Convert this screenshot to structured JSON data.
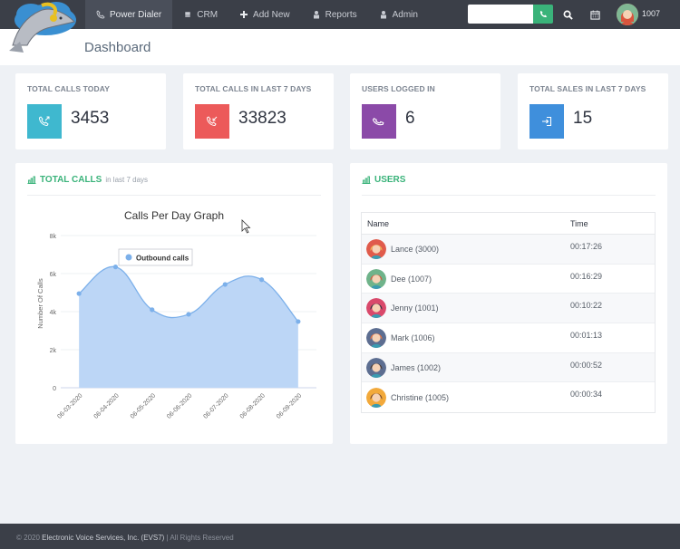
{
  "nav": {
    "items": [
      {
        "label": "Power Dialer",
        "icon": "phone-icon",
        "active": true
      },
      {
        "label": "CRM",
        "icon": "book-icon",
        "active": false
      },
      {
        "label": "Add New",
        "icon": "plus-icon",
        "active": false
      },
      {
        "label": "Reports",
        "icon": "user-icon",
        "active": false
      },
      {
        "label": "Admin",
        "icon": "user-icon",
        "active": false
      }
    ],
    "dial_input": {
      "value": "",
      "placeholder": ""
    },
    "user_extension": "1007"
  },
  "page": {
    "title": "Dashboard"
  },
  "stats": [
    {
      "label": "TOTAL CALLS TODAY",
      "value": "3453",
      "icon": "outgoing-call-icon",
      "color": "#3fb8cf"
    },
    {
      "label": "TOTAL CALLS IN LAST 7 DAYS",
      "value": "33823",
      "icon": "incoming-call-icon",
      "color": "#ec5a5a"
    },
    {
      "label": "USERS LOGGED IN",
      "value": "6",
      "icon": "phone-icon",
      "color": "#8b4aa8"
    },
    {
      "label": "TOTAL SALES IN LAST 7 DAYS",
      "value": "15",
      "icon": "sign-in-icon",
      "color": "#3f8fdc"
    }
  ],
  "calls_panel": {
    "title": "TOTAL CALLS",
    "subtitle": "in last 7 days"
  },
  "users_panel": {
    "title": "USERS",
    "columns": [
      "Name",
      "Time"
    ],
    "rows": [
      {
        "name": "Lance (3000)",
        "time": "00:17:26",
        "avatar_bg": "#e05b4b",
        "hair": "#f0b64a"
      },
      {
        "name": "Dee (1007)",
        "time": "00:16:29",
        "avatar_bg": "#6fb38a",
        "hair": "#d9553e"
      },
      {
        "name": "Jenny (1001)",
        "time": "00:10:22",
        "avatar_bg": "#d9496b",
        "hair": "#2f3440"
      },
      {
        "name": "Mark (1006)",
        "time": "00:01:13",
        "avatar_bg": "#5d6e91",
        "hair": "#e8713e"
      },
      {
        "name": "James (1002)",
        "time": "00:00:52",
        "avatar_bg": "#5d6e91",
        "hair": "#4a3a30"
      },
      {
        "name": "Christine (1005)",
        "time": "00:00:34",
        "avatar_bg": "#f2a93b",
        "hair": "#7a4a2a"
      }
    ]
  },
  "chart_data": {
    "type": "area",
    "title": "Calls Per Day Graph",
    "xlabel": "",
    "ylabel": "Number Of Calls",
    "categories": [
      "06-03-2020",
      "06-04-2020",
      "06-05-2020",
      "06-06-2020",
      "06-07-2020",
      "06-08-2020",
      "06-09-2020"
    ],
    "series": [
      {
        "name": "Outbound calls",
        "values": [
          4950,
          6350,
          4100,
          3860,
          5430,
          5680,
          3480
        ],
        "color": "#7cb0ea"
      }
    ],
    "yticks": [
      "0",
      "2k",
      "4k",
      "6k",
      "8k"
    ],
    "ylim": [
      0,
      8000
    ],
    "grid": true,
    "legend": "top-left"
  },
  "footer": {
    "copyright": "© 2020",
    "company": "Electronic Voice Services, Inc. (EVS7)",
    "rights": "| All Rights Reserved"
  }
}
